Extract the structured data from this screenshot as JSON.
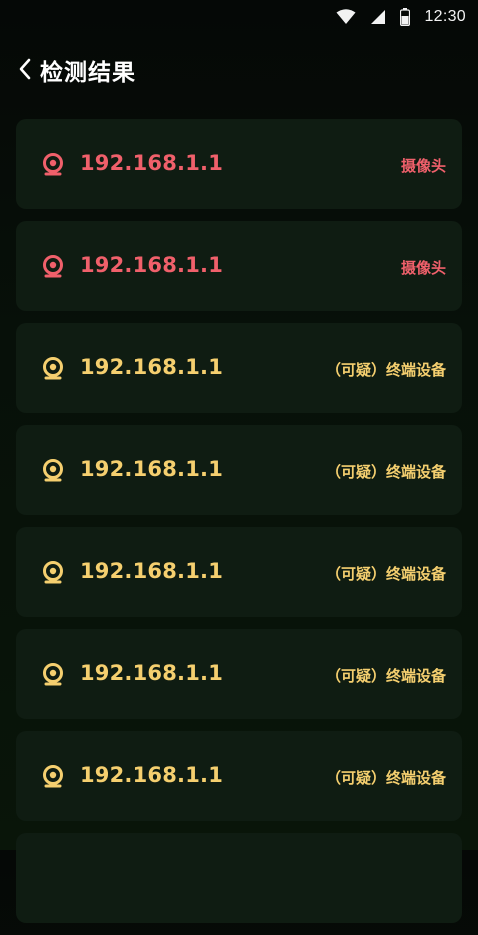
{
  "status_bar": {
    "time": "12:30",
    "icons": [
      "wifi-icon",
      "cellular-signal-icon",
      "battery-icon"
    ]
  },
  "header": {
    "back_icon": "chevron-left-icon",
    "title": "检测结果"
  },
  "colors": {
    "camera_accent": "#f0606b",
    "suspect_accent": "#f5cf6f",
    "card_background": "#0f1c12",
    "page_background": "#060b07"
  },
  "results": [
    {
      "ip": "192.168.1.1",
      "type": "摄像头",
      "status": "alert",
      "icon": "webcam-icon"
    },
    {
      "ip": "192.168.1.1",
      "type": "摄像头",
      "status": "alert",
      "icon": "webcam-icon"
    },
    {
      "ip": "192.168.1.1",
      "type": "（可疑）终端设备",
      "status": "suspect",
      "icon": "webcam-icon"
    },
    {
      "ip": "192.168.1.1",
      "type": "（可疑）终端设备",
      "status": "suspect",
      "icon": "webcam-icon"
    },
    {
      "ip": "192.168.1.1",
      "type": "（可疑）终端设备",
      "status": "suspect",
      "icon": "webcam-icon"
    },
    {
      "ip": "192.168.1.1",
      "type": "（可疑）终端设备",
      "status": "suspect",
      "icon": "webcam-icon"
    },
    {
      "ip": "192.168.1.1",
      "type": "（可疑）终端设备",
      "status": "suspect",
      "icon": "webcam-icon"
    }
  ]
}
